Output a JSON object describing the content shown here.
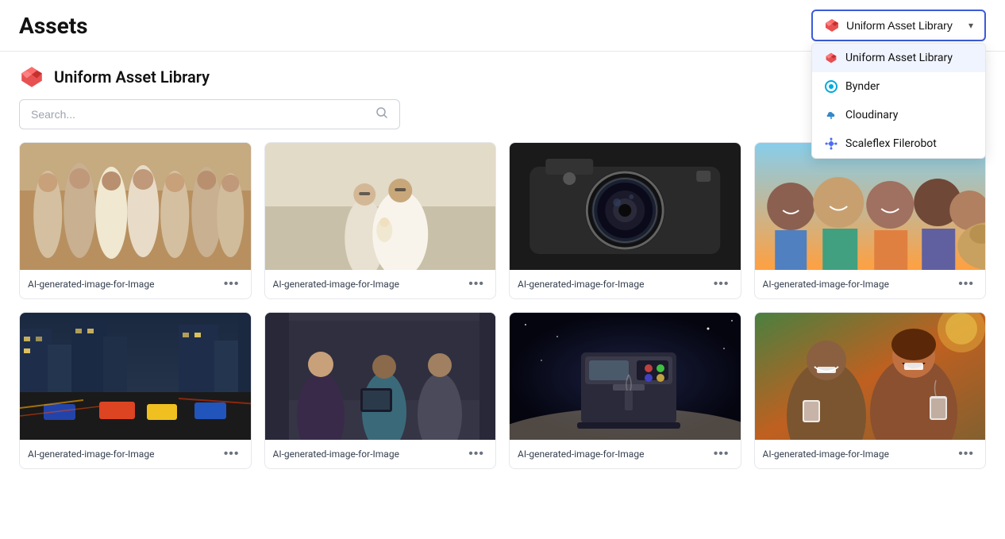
{
  "header": {
    "title": "Assets",
    "selector": {
      "label": "Uniform Asset Library",
      "chevron": "▾"
    }
  },
  "subheader": {
    "library_name": "Uniform Asset Library"
  },
  "search": {
    "placeholder": "Search..."
  },
  "dropdown": {
    "items": [
      {
        "id": "uniform",
        "label": "Uniform Asset Library",
        "active": true
      },
      {
        "id": "bynder",
        "label": "Bynder",
        "active": false
      },
      {
        "id": "cloudinary",
        "label": "Cloudinary",
        "active": false
      },
      {
        "id": "scaleflex",
        "label": "Scaleflex Filerobot",
        "active": false
      }
    ]
  },
  "assets": [
    {
      "id": 1,
      "name": "AI-generated-image-for-Image",
      "color": "bridesmaids"
    },
    {
      "id": 2,
      "name": "AI-generated-image-for-Image",
      "color": "wedding-couple"
    },
    {
      "id": 3,
      "name": "AI-generated-image-for-Image",
      "color": "camera"
    },
    {
      "id": 4,
      "name": "AI-generated-image-for-Image",
      "color": "friends-selfie"
    },
    {
      "id": 5,
      "name": "AI-generated-image-for-Image",
      "color": "city-traffic"
    },
    {
      "id": 6,
      "name": "AI-generated-image-for-Image",
      "color": "business-meeting"
    },
    {
      "id": 7,
      "name": "AI-generated-image-for-Image",
      "color": "coffee-machine"
    },
    {
      "id": 8,
      "name": "AI-generated-image-for-Image",
      "color": "laughing-couple"
    }
  ],
  "asset_menu_label": "•••"
}
